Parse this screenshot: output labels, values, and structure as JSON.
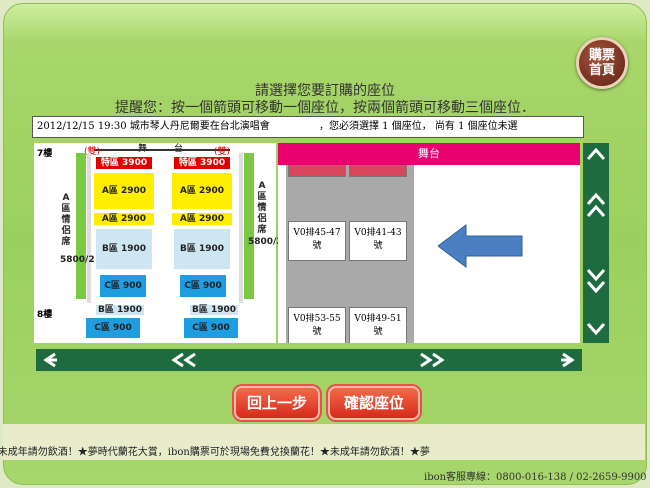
{
  "home_button": {
    "line1": "購票",
    "line2": "首頁"
  },
  "instructions": {
    "line1": "請選擇您要訂購的座位",
    "line2": "提醒您：按一個箭頭可移動一個座位，按兩個箭頭可移動三個座位．"
  },
  "event_bar": {
    "event": "2012/12/15 19:30 城市琴人丹尼爾要在台北演唱會",
    "message": "，您必須選擇 1 個座位， 尚有 1 個座位未選"
  },
  "venue": {
    "floor7": "7樓",
    "floor8": "8樓",
    "stage_left": "舞",
    "stage_right": "台",
    "marker_left": "(雙)",
    "marker_right": "(雙)",
    "zone_special": "特區 3900",
    "zone_a": "A區 2900",
    "zone_b": "B區 1900",
    "zone_c": "C區 900",
    "couple_label": "A區情侶席",
    "couple_price": "5800/2"
  },
  "seat_panel": {
    "stage_label": "舞台",
    "seats": [
      {
        "line1": "V0排45-47",
        "line2": "號"
      },
      {
        "line1": "V0排41-43",
        "line2": "號"
      },
      {
        "line1": "V0排53-55",
        "line2": "號"
      },
      {
        "line1": "V0排49-51",
        "line2": "號"
      }
    ]
  },
  "buttons": {
    "back": "回上一步",
    "confirm": "確認座位"
  },
  "ticker": {
    "text": "r未成年請勿飲酒！★夢時代蘭花大賞，ibon購票可於現場免費兌換蘭花！★未成年請勿飲酒！★夢"
  },
  "service": {
    "text": "ibon客服專線：0800-016-138 / 02-2659-9900"
  },
  "colors": {
    "nav_green": "#1d6b3f",
    "stage_pink": "#e8006e",
    "arrow_blue": "#4a7fc1",
    "button_red": "#d62a1c"
  }
}
